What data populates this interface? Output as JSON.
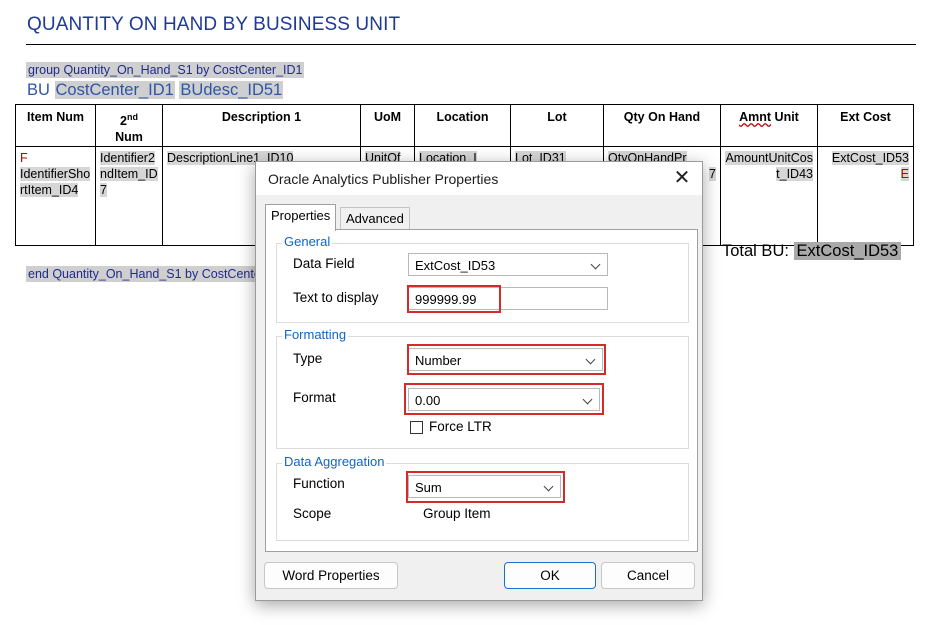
{
  "document": {
    "title": "QUANTITY ON HAND BY BUSINESS UNIT",
    "group_start": "group Quantity_On_Hand_S1 by CostCenter_ID1",
    "bu_prefix": "BU",
    "bu_field1": "CostCenter_ID1",
    "bu_field2": "BUdesc_ID51",
    "group_end": "end Quantity_On_Hand_S1 by CostCenter_ID1",
    "total_label": "Total BU:",
    "total_field": "ExtCost_ID53",
    "table": {
      "headers": {
        "item_num": "Item Num",
        "num2_main": "2",
        "num2_sup": "nd",
        "num2_word": "Num",
        "description": "Description 1",
        "uom": "UoM",
        "location": "Location",
        "lot": "Lot",
        "qty": "Qty On Hand",
        "amnt_word": "Amnt",
        "amnt_rest": " Unit",
        "ext_cost": "Ext Cost"
      },
      "row": {
        "item_f": "F",
        "item_value": "IdentifierShortItem_ID4",
        "num2": "Identifier2ndItem_ID7",
        "description": "DescriptionLine1_ID10",
        "uom": "UnitOf",
        "location": "Location_I",
        "lot": "Lot_ID31",
        "qty": "QtyOnHandPr",
        "qty_tail": "7",
        "amount": "AmountUnitCost_ID43",
        "ext_cost": "ExtCost_ID53",
        "ext_cost_e": "E"
      }
    }
  },
  "dialog": {
    "title": "Oracle Analytics Publisher Properties",
    "close_symbol": "✕",
    "tabs": [
      "Properties",
      "Advanced"
    ],
    "general": {
      "label": "General",
      "data_field_label": "Data Field",
      "data_field_value": "ExtCost_ID53",
      "text_label": "Text to display",
      "text_value": "999999.99"
    },
    "formatting": {
      "label": "Formatting",
      "type_label": "Type",
      "type_value": "Number",
      "format_label": "Format",
      "format_value": "0.00",
      "force_ltr_label": "Force LTR",
      "force_ltr_checked": false
    },
    "aggregation": {
      "label": "Data Aggregation",
      "function_label": "Function",
      "function_value": "Sum",
      "scope_label": "Scope",
      "scope_value": "Group Item"
    },
    "buttons": {
      "word_properties": "Word Properties",
      "ok": "OK",
      "cancel": "Cancel"
    },
    "colors": {
      "highlight_box": "#d42a2a",
      "group_label": "#1166c2",
      "ok_border": "#1a73c9"
    }
  },
  "document_colors": {
    "title": "#1f3a93",
    "group_text": "#1f2c8c",
    "field_shading": "#cfcfcf"
  }
}
